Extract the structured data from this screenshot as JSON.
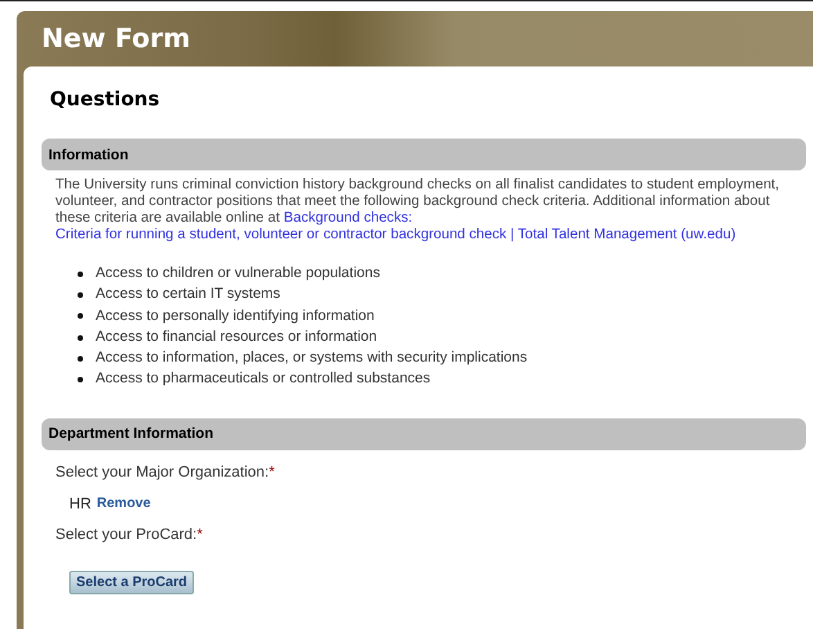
{
  "window": {
    "title": "New Form"
  },
  "page_heading": "Questions",
  "sections": [
    {
      "kind": "info",
      "title": "Information",
      "text": "The University runs criminal conviction history background checks on all finalist candidates to student employment, volunteer, and contractor positions that meet the following background check criteria. Additional information about these criteria are available online at",
      "link_lines": [
        "Background checks:",
        "Criteria for running a student, volunteer or contractor background check | Total Talent Management",
        "(uw.edu)"
      ],
      "bullets": [
        "Access to children or vulnerable populations",
        "Access to certain IT systems",
        "Access to personally identifying information",
        "Access to financial resources or information",
        "Access to information, places, or systems with security implications",
        "Access to pharmaceuticals or controlled substances"
      ]
    },
    {
      "kind": "fields",
      "title": "Department Information",
      "fields": [
        {
          "kind": "selection",
          "label": "Select your Major Organization:",
          "required_marker": "*",
          "value": "HR",
          "action": "Remove"
        },
        {
          "kind": "picker",
          "label": "Select your ProCard:",
          "required_marker": "*",
          "button": "Select a ProCard"
        }
      ]
    }
  ]
}
